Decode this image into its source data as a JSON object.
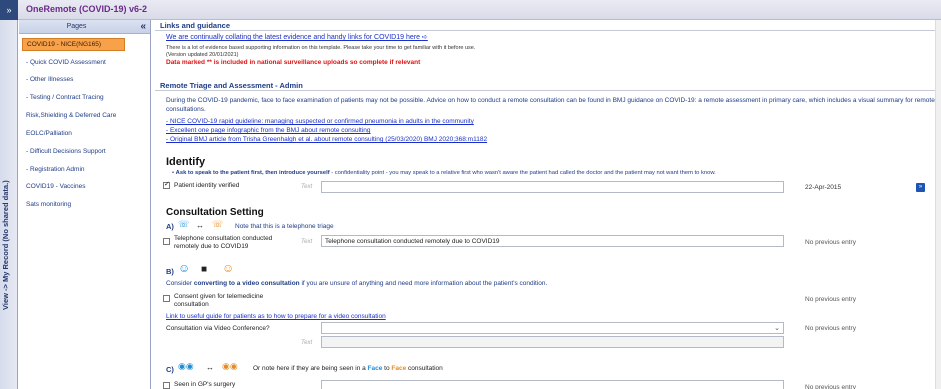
{
  "app": {
    "title": "OneRemote (COVID-19) v6-2"
  },
  "side_strip": {
    "label": "View -> My Record (No shared data.)"
  },
  "pages_panel": {
    "title": "Pages",
    "items": [
      {
        "label": "COVID19 - NICE(NG165)",
        "active": true
      },
      {
        "label": "- Quick COVID Assessment"
      },
      {
        "label": "- Other Illnesses"
      },
      {
        "label": "- Testing / Contract Tracing"
      },
      {
        "label": "Risk,Shielding & Deferred Care"
      },
      {
        "label": "EOLC/Palliation"
      },
      {
        "label": "- Difficult Decisions Support"
      },
      {
        "label": "- Registration Admin"
      },
      {
        "label": "COVID19 - Vaccines"
      },
      {
        "label": "Sats monitoring"
      }
    ]
  },
  "links_section": {
    "heading": "Links and guidance",
    "link": "We are continually collating the latest evidence and handy links for COVID19 here",
    "note1": "There is a lot of evidence based supporting information on this template. Please take your time to get familiar with it before use.",
    "note2": "(Version updated 20/01/2021)",
    "warning": "Data marked ** is included in national surveillance uploads so complete if relevant"
  },
  "triage_section": {
    "heading": "Remote Triage and Assessment - Admin",
    "intro": "During the COVID-19 pandemic, face to face examination of patients may not be possible. Advice on how to conduct a remote consultation can be found in BMJ guidance on COVID-19: a remote assessment in primary care, which includes a visual summary for remote consultations.",
    "links": [
      "- NICE COVID-19 rapid guideline: managing suspected or confirmed pneumonia in adults in the community",
      "- Excellent one page infographic from the BMJ about remote consulting",
      "- Original BMJ article from Trisha Greenhalgh et al. about remote consulting  (25/03/2020) BMJ 2020;368:m1182"
    ]
  },
  "identify": {
    "heading": "Identify",
    "instruction_bold": "Ask to speak to the patient first, then introduce yourself",
    "instruction_rest": " - confidentiality point - you may speak to a relative first who wasn't aware the patient had called the doctor and the patient may not want them to know.",
    "checkbox_label": "Patient identity verified",
    "placeholder": "Text",
    "value": "",
    "date": "22-Apr-2015"
  },
  "consultation": {
    "heading": "Consultation Setting",
    "a_label": "A)",
    "a_note": "Note that this is a telephone triage",
    "tel_label_1": "Telephone consultation conducted",
    "tel_label_2": "remotely due to COVID19",
    "tel_placeholder": "Text",
    "tel_value": "Telephone consultation conducted remotely due to COVID19",
    "no_previous": "No previous entry",
    "b_label": "B)",
    "b_text_1": "Consider ",
    "b_text_bold": "converting to a video consultation",
    "b_text_2": " if you are unsure of anything and need more information about the patient's condition.",
    "consent_label_1": "Consent given for telemedicine",
    "consent_label_2": "consultation",
    "guide_link": "Link to useful guide for patients as to how to prepare for a video consultation",
    "video_label": "Consultation via Video Conference?",
    "video_placeholder": "Text",
    "c_label": "C)",
    "c_note_1": "Or note here if they are being seen in a ",
    "c_face": "Face",
    "c_to": " to ",
    "c_face2": "Face",
    "c_note_2": " consultation",
    "gp_label": "Seen in GP's surgery"
  },
  "colors": {
    "accent": "#1f3c86",
    "active_page": "#f7a24a",
    "warning": "#dd1111",
    "link": "#1a2fc9"
  }
}
